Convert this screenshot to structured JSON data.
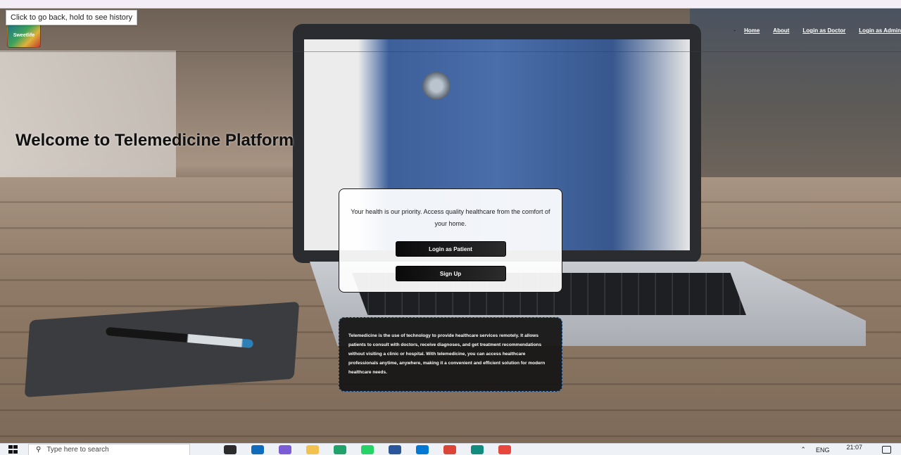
{
  "browser": {
    "tooltip": "Click to go back, hold to see history"
  },
  "nav": {
    "logo_text": "Sweetlife",
    "links": [
      "Home",
      "About",
      "Login as Doctor",
      "Login as Admin"
    ]
  },
  "hero": {
    "title": "Welcome to Telemedicine Platform"
  },
  "card": {
    "tagline": "Your health is our priority. Access quality healthcare from the comfort of your home.",
    "login_patient_label": "Login as Patient",
    "signup_label": "Sign Up"
  },
  "info": {
    "text": "Telemedicine is the use of technology to provide healthcare services remotely. It allows patients to consult with doctors, receive diagnoses, and get treatment recommendations without visiting a clinic or hospital. With telemedicine, you can access healthcare professionals anytime, anywhere, making it a convenient and efficient solution for modern healthcare needs."
  },
  "taskbar": {
    "search_placeholder": "Type here to search",
    "language": "ENG",
    "time": "21:07",
    "apps": [
      {
        "name": "task-view-icon",
        "color": "#2b2b2b"
      },
      {
        "name": "outlook-icon",
        "color": "#0f6cbd"
      },
      {
        "name": "copilot-icon",
        "color": "#7b5cd6"
      },
      {
        "name": "file-explorer-icon",
        "color": "#f2c14e"
      },
      {
        "name": "edge-icon",
        "color": "#1fa36a"
      },
      {
        "name": "whatsapp-icon",
        "color": "#25d366"
      },
      {
        "name": "word-icon",
        "color": "#2b579a"
      },
      {
        "name": "vscode-icon",
        "color": "#0078d4"
      },
      {
        "name": "chrome-icon",
        "color": "#db4437"
      },
      {
        "name": "whatsapp-alt-icon",
        "color": "#128c7e"
      },
      {
        "name": "chrome-alt-icon",
        "color": "#e8453c"
      }
    ]
  }
}
